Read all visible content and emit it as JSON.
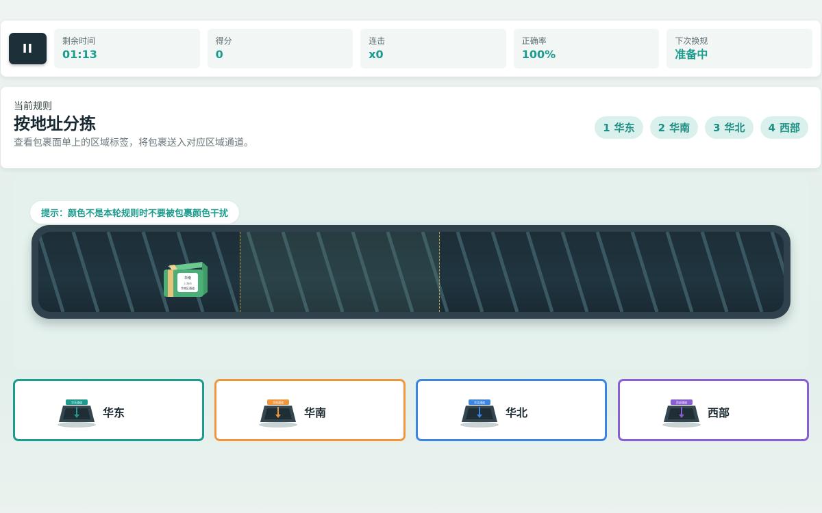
{
  "hud": {
    "pause_label": "II",
    "stats": [
      {
        "label": "剩余时间",
        "value": "01:13"
      },
      {
        "label": "得分",
        "value": "0"
      },
      {
        "label": "连击",
        "value": "x0"
      },
      {
        "label": "正确率",
        "value": "100%"
      },
      {
        "label": "下次换规",
        "value": "准备中"
      }
    ]
  },
  "rule": {
    "kicker": "当前规则",
    "title": "按地址分拣",
    "description": "查看包裹面单上的区域标签，将包裹送入对应区域通道。",
    "keys": [
      {
        "key": "1",
        "label": "华东"
      },
      {
        "key": "2",
        "label": "华南"
      },
      {
        "key": "3",
        "label": "华北"
      },
      {
        "key": "4",
        "label": "西部"
      }
    ]
  },
  "hint": "提示：颜色不是本轮规则时不要被包裹颜色干扰",
  "package": {
    "color": "#4caf78",
    "tape_color": "#e9c37c",
    "label_line1": "华南",
    "label_line2": "上海市",
    "label_line3": "华南区通道"
  },
  "bins": [
    {
      "label": "华东",
      "tag": "华东通道",
      "color": "#1c9b8e"
    },
    {
      "label": "华南",
      "tag": "华南通道",
      "color": "#f0973d"
    },
    {
      "label": "华北",
      "tag": "华北通道",
      "color": "#3d86e0"
    },
    {
      "label": "西部",
      "tag": "西部通道",
      "color": "#8a5fd1"
    }
  ]
}
